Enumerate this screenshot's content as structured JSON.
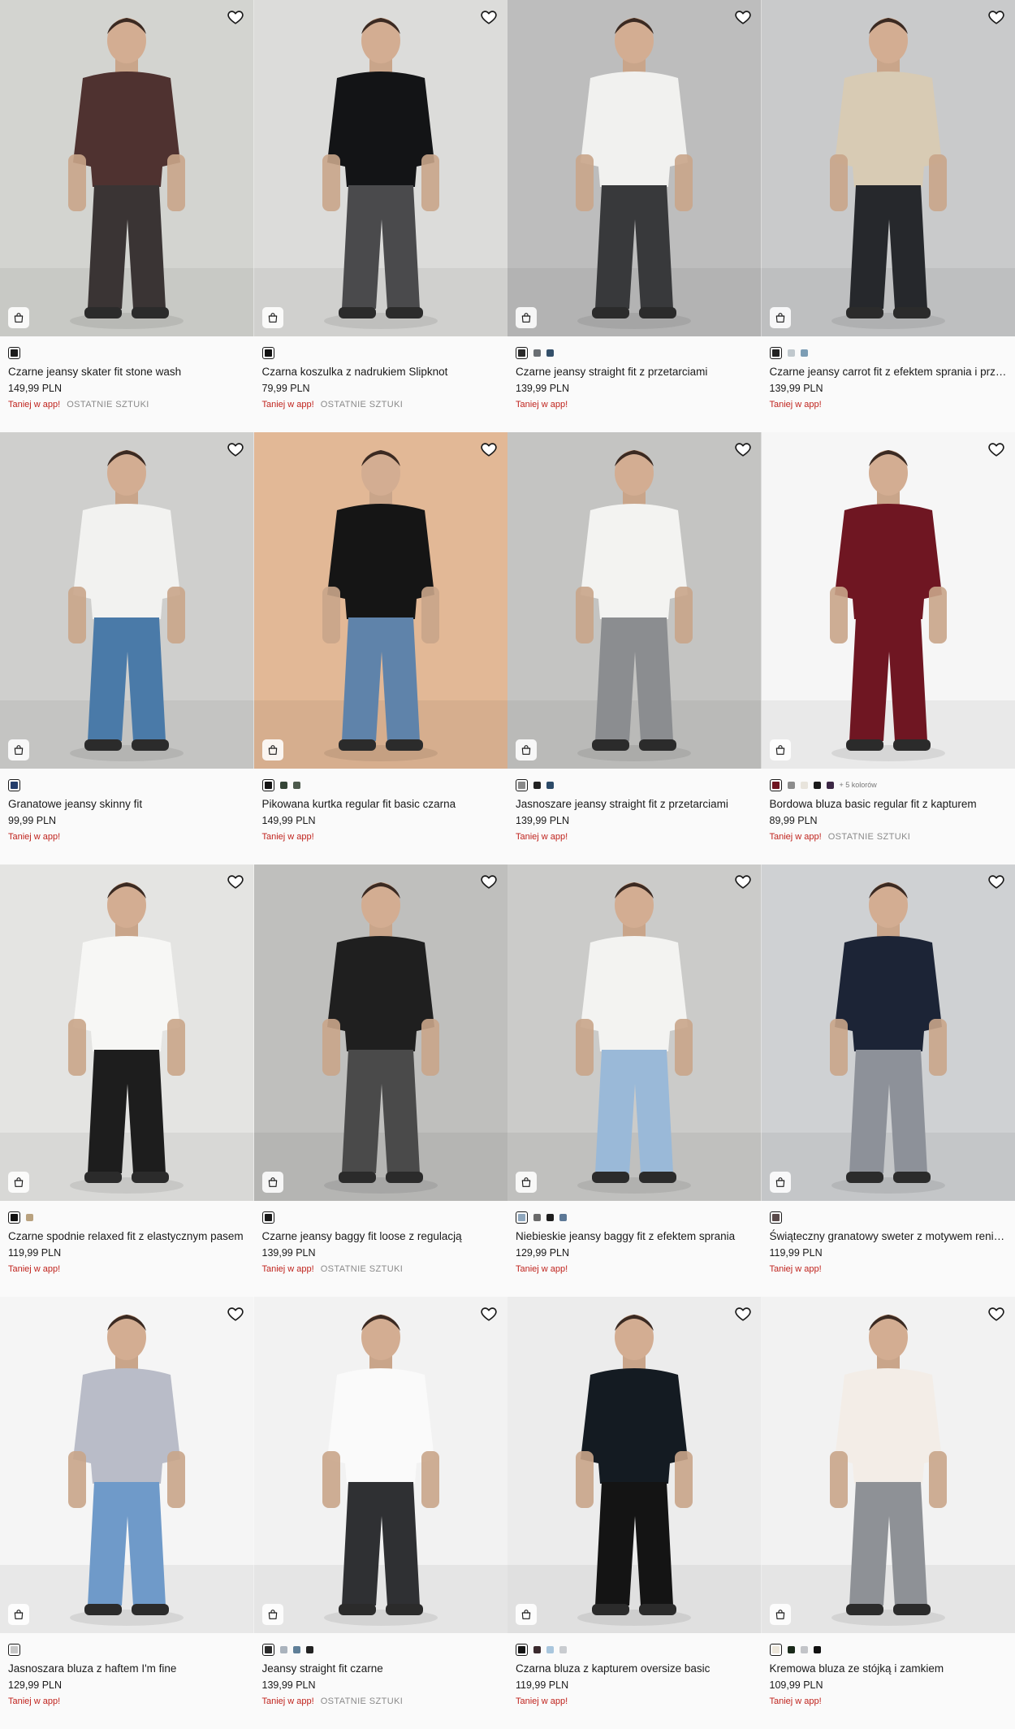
{
  "products": [
    {
      "name": "Czarne jeansy skater fit stone wash",
      "price": "149,99 PLN",
      "promo": "Taniej w app!",
      "badge": "OSTATNIE SZTUKI",
      "bg": "#d3d4d0",
      "top": "#4f3230",
      "bottom": "#3a3434",
      "swatches": [
        "#1c1c1c"
      ],
      "more": ""
    },
    {
      "name": "Czarna koszulka z nadrukiem Slipknot",
      "price": "79,99 PLN",
      "promo": "Taniej w app!",
      "badge": "OSTATNIE SZTUKI",
      "bg": "#dcdcda",
      "top": "#131416",
      "bottom": "#4a4a4c",
      "swatches": [
        "#111111"
      ],
      "more": ""
    },
    {
      "name": "Czarne jeansy straight fit z przetarciami",
      "price": "139,99 PLN",
      "promo": "Taniej w app!",
      "badge": "",
      "bg": "#bdbdbd",
      "top": "#f1f1ef",
      "bottom": "#38393b",
      "swatches": [
        "#2a2a2a",
        "#6a6f73",
        "#34506a"
      ],
      "more": ""
    },
    {
      "name": "Czarne jeansy carrot fit z efektem sprania i przetarciami",
      "price": "139,99 PLN",
      "promo": "Taniej w app!",
      "badge": "",
      "bg": "#c9cacb",
      "top": "#d8cbb4",
      "bottom": "#26282c",
      "swatches": [
        "#222222",
        "#c0c8cd",
        "#7c9db4"
      ],
      "more": ""
    },
    {
      "name": "Granatowe jeansy skinny fit",
      "price": "99,99 PLN",
      "promo": "Taniej w app!",
      "badge": "",
      "bg": "#cfcfcd",
      "top": "#f2f2f0",
      "bottom": "#4a7aa8",
      "swatches": [
        "#243d6b"
      ],
      "more": ""
    },
    {
      "name": "Pikowana kurtka regular fit basic czarna",
      "price": "149,99 PLN",
      "promo": "Taniej w app!",
      "badge": "",
      "bg": "#e2b896",
      "top": "#151515",
      "bottom": "#5f83aa",
      "swatches": [
        "#151515",
        "#354536",
        "#4d5a4c"
      ],
      "more": ""
    },
    {
      "name": "Jasnoszare jeansy straight fit z przetarciami",
      "price": "139,99 PLN",
      "promo": "Taniej w app!",
      "badge": "",
      "bg": "#c4c4c2",
      "top": "#f3f3f1",
      "bottom": "#8b8d90",
      "swatches": [
        "#8a8a8a",
        "#222222",
        "#2c4a68"
      ],
      "more": ""
    },
    {
      "name": "Bordowa bluza basic regular fit z kapturem",
      "price": "89,99 PLN",
      "promo": "Taniej w app!",
      "badge": "OSTATNIE SZTUKI",
      "bg": "#f6f6f6",
      "top": "#6f1622",
      "bottom": "#6f1622",
      "swatches": [
        "#6f1622",
        "#8c8c8c",
        "#e8e4dc",
        "#1a1a1a",
        "#3c2745"
      ],
      "more": "+ 5 kolorów"
    },
    {
      "name": "Czarne spodnie relaxed fit z elastycznym pasem",
      "price": "119,99 PLN",
      "promo": "Taniej w app!",
      "badge": "",
      "bg": "#e4e4e2",
      "top": "#f7f7f5",
      "bottom": "#1d1d1d",
      "swatches": [
        "#111111",
        "#b9a27f"
      ],
      "more": ""
    },
    {
      "name": "Czarne jeansy baggy fit loose z regulacją",
      "price": "139,99 PLN",
      "promo": "Taniej w app!",
      "badge": "OSTATNIE SZTUKI",
      "bg": "#bfbfbd",
      "top": "#1f1f1f",
      "bottom": "#4a4a4a",
      "swatches": [
        "#1a1a1a"
      ],
      "more": ""
    },
    {
      "name": "Niebieskie jeansy baggy fit z efektem sprania",
      "price": "129,99 PLN",
      "promo": "Taniej w app!",
      "badge": "",
      "bg": "#cbcbc9",
      "top": "#f3f3f1",
      "bottom": "#9ab9d8",
      "swatches": [
        "#8fa7bd",
        "#6a6a6a",
        "#1e1e1e",
        "#5c7896"
      ],
      "more": ""
    },
    {
      "name": "Świąteczny granatowy sweter z motywem reniferów",
      "price": "119,99 PLN",
      "promo": "Taniej w app!",
      "badge": "",
      "bg": "#cfd1d3",
      "top": "#1c2436",
      "bottom": "#8d9199",
      "swatches": [
        "#5a4a4a"
      ],
      "more": ""
    },
    {
      "name": "Jasnoszara bluza z haftem I'm fine",
      "price": "129,99 PLN",
      "promo": "Taniej w app!",
      "badge": "",
      "bg": "#f5f5f5",
      "top": "#b9bcc8",
      "bottom": "#6f9ac9",
      "swatches": [
        "#c6c6c6"
      ],
      "more": ""
    },
    {
      "name": "Jeansy straight fit czarne",
      "price": "139,99 PLN",
      "promo": "Taniej w app!",
      "badge": "OSTATNIE SZTUKI",
      "bg": "#f2f2f2",
      "top": "#fafafa",
      "bottom": "#2f3033",
      "swatches": [
        "#2a2a2a",
        "#aab3bd",
        "#5f7f98",
        "#222222"
      ],
      "more": ""
    },
    {
      "name": "Czarna bluza z kapturem oversize basic",
      "price": "119,99 PLN",
      "promo": "Taniej w app!",
      "badge": "",
      "bg": "#ececec",
      "top": "#141b22",
      "bottom": "#141414",
      "swatches": [
        "#141414",
        "#3b2a2e",
        "#a9c6dd",
        "#c9ccd0"
      ],
      "more": ""
    },
    {
      "name": "Kremowa bluza ze stójką i zamkiem",
      "price": "109,99 PLN",
      "promo": "Taniej w app!",
      "badge": "",
      "bg": "#f2f2f2",
      "top": "#f3ede7",
      "bottom": "#8e9196",
      "swatches": [
        "#ece6da",
        "#1a2a1a",
        "#c2c4c8",
        "#111111"
      ],
      "more": ""
    }
  ]
}
